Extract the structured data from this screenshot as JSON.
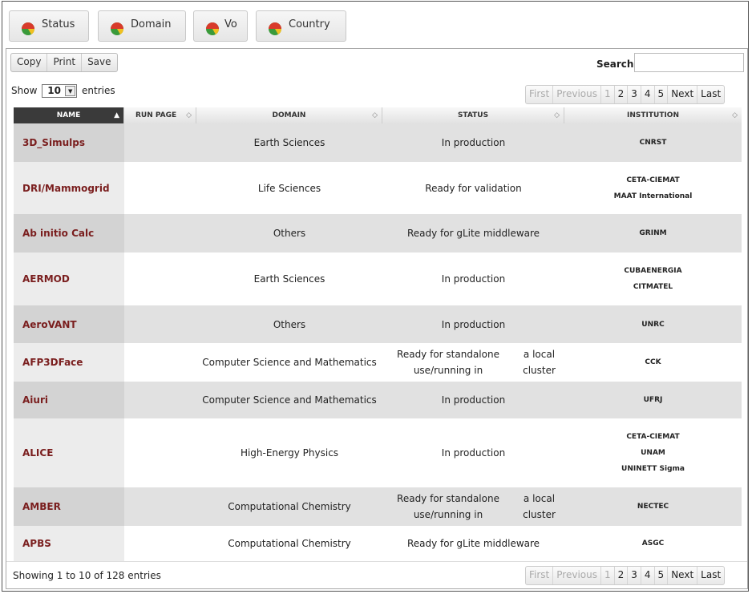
{
  "tabs": [
    {
      "label": "Status",
      "icon": "pie-chart-icon"
    },
    {
      "label": "Domain",
      "icon": "pie-chart-icon"
    },
    {
      "label": "Vo",
      "icon": "pie-chart-icon"
    },
    {
      "label": "Country",
      "icon": "pie-chart-icon"
    }
  ],
  "toolbar": {
    "copy": "Copy",
    "print": "Print",
    "save": "Save"
  },
  "search": {
    "label": "Search:",
    "value": ""
  },
  "length": {
    "show": "Show",
    "value": "10",
    "entries": "entries"
  },
  "pager": {
    "first": "First",
    "previous": "Previous",
    "pages": [
      "1",
      "2",
      "3",
      "4",
      "5"
    ],
    "current": "1",
    "next": "Next",
    "last": "Last"
  },
  "columns": {
    "name": "NAME",
    "run_page": "RUN PAGE",
    "domain": "DOMAIN",
    "status": "STATUS",
    "institution": "INSTITUTION"
  },
  "rows": [
    {
      "name": "3D_Simulps",
      "run_page": "",
      "domain": "Earth Sciences",
      "status": [
        "In production"
      ],
      "institution": [
        "CNRST"
      ]
    },
    {
      "name": "DRI/Mammogrid",
      "run_page": "",
      "domain": "Life Sciences",
      "status": [
        "Ready for validation"
      ],
      "institution": [
        "CETA-CIEMAT",
        "MAAT International"
      ]
    },
    {
      "name": "Ab initio Calc",
      "run_page": "",
      "domain": "Others",
      "status": [
        "Ready for gLite middleware"
      ],
      "institution": [
        "GRINM"
      ]
    },
    {
      "name": "AERMOD",
      "run_page": "",
      "domain": "Earth Sciences",
      "status": [
        "In production"
      ],
      "institution": [
        "CUBAENERGIA",
        "CITMATEL"
      ]
    },
    {
      "name": "AeroVANT",
      "run_page": "",
      "domain": "Others",
      "status": [
        "In production"
      ],
      "institution": [
        "UNRC"
      ]
    },
    {
      "name": "AFP3DFace",
      "run_page": "",
      "domain": "Computer Science and Mathematics",
      "status": [
        "Ready for standalone use/running in",
        "a local cluster"
      ],
      "institution": [
        "CCK"
      ]
    },
    {
      "name": "Aiuri",
      "run_page": "",
      "domain": "Computer Science and Mathematics",
      "status": [
        "In production"
      ],
      "institution": [
        "UFRJ"
      ]
    },
    {
      "name": "ALICE",
      "run_page": "",
      "domain": "High-Energy Physics",
      "status": [
        "In production"
      ],
      "institution": [
        "CETA-CIEMAT",
        "UNAM",
        "UNINETT Sigma"
      ]
    },
    {
      "name": "AMBER",
      "run_page": "",
      "domain": "Computational Chemistry",
      "status": [
        "Ready for standalone use/running in",
        "a local cluster"
      ],
      "institution": [
        "NECTEC"
      ]
    },
    {
      "name": "APBS",
      "run_page": "",
      "domain": "Computational Chemistry",
      "status": [
        "Ready for gLite middleware"
      ],
      "institution": [
        "ASGC"
      ]
    }
  ],
  "info": "Showing 1 to 10 of 128 entries",
  "colors": {
    "name_link": "#7a1e1e",
    "sorted_header": "#3a3a3a",
    "odd_row": "#e1e1e1"
  }
}
